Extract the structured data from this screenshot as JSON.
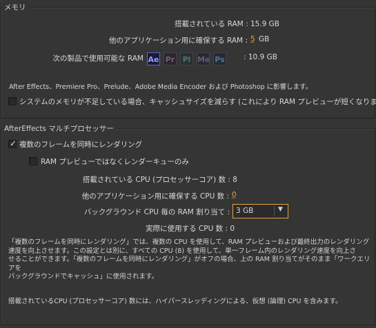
{
  "memory": {
    "legend": "メモリ",
    "installed_ram": "搭載されている RAM : 15.9 GB",
    "reserved_label": "他のアプリケーション用に確保する RAM :",
    "reserved_value": "5",
    "reserved_unit": "GB",
    "available_label": "次の製品で使用可能な RAM",
    "available_value": ": 10.9 GB",
    "apps": [
      {
        "abbr": "Ae",
        "color": "#9999ff",
        "bg": "#1a1a3a",
        "active": true
      },
      {
        "abbr": "Pr",
        "color": "#8a6a9a",
        "bg": "#2a2030",
        "active": false
      },
      {
        "abbr": "Pl",
        "color": "#5e8a8a",
        "bg": "#203030",
        "active": false
      },
      {
        "abbr": "Me",
        "color": "#6a6a8a",
        "bg": "#252535",
        "active": false
      },
      {
        "abbr": "Ps",
        "color": "#5a8ab0",
        "bg": "#1c2a38",
        "active": false
      }
    ],
    "shared_note": "After Effects、Premiere Pro、Prelude、Adobe Media Encoder および Photoshop に影響します。",
    "reduce_cache_label": "システムのメモリが不足している場合、キャッシュサイズを減らす (これにより RAM プレビューが短くなります)",
    "reduce_cache_checked": false
  },
  "mp": {
    "legend": "AfterEffects マルチプロセッサー",
    "render_multiple_label": "複数のフレームを同時にレンダリング",
    "render_multiple_checked": true,
    "ram_preview_only_label": "RAM プレビューではなくレンダーキューのみ",
    "ram_preview_only_checked": false,
    "installed_cpu": "搭載されている CPU (プロセッサーコア) 数 : 8",
    "reserved_cpu_label": "他のアプリケーション用に確保する CPU 数 :",
    "reserved_cpu_value": "0",
    "ram_alloc_label": "バックグラウンド CPU 毎の RAM 割り当て :",
    "ram_alloc_value": "3 GB",
    "actual_cpu": "実際に使用する CPU 数 : 0",
    "para1": [
      "「複数のフレームを同時にレンダリング」では、複数の CPU を使用して、RAM プレビューおよび最終出力のレンダリング",
      "速度を向上させます。この設定とは別に、すべての CPU (8) を使用して、単一フレーム内のレンダリング速度を向上さ",
      "せることができます。「複数のフレームを同時にレンダリング」がオフの場合、上の RAM 割り当てがそのまま「ワークエリアを",
      "バックグラウンドでキャッシュ」に使用されます。"
    ],
    "para2": "搭載されているCPU (プロセッサーコア) 数には、ハイパースレッディングによる、仮想 (論理) CPU を含みます。"
  },
  "colors": {
    "accent": "#e8a33c",
    "panel": "#353535"
  }
}
